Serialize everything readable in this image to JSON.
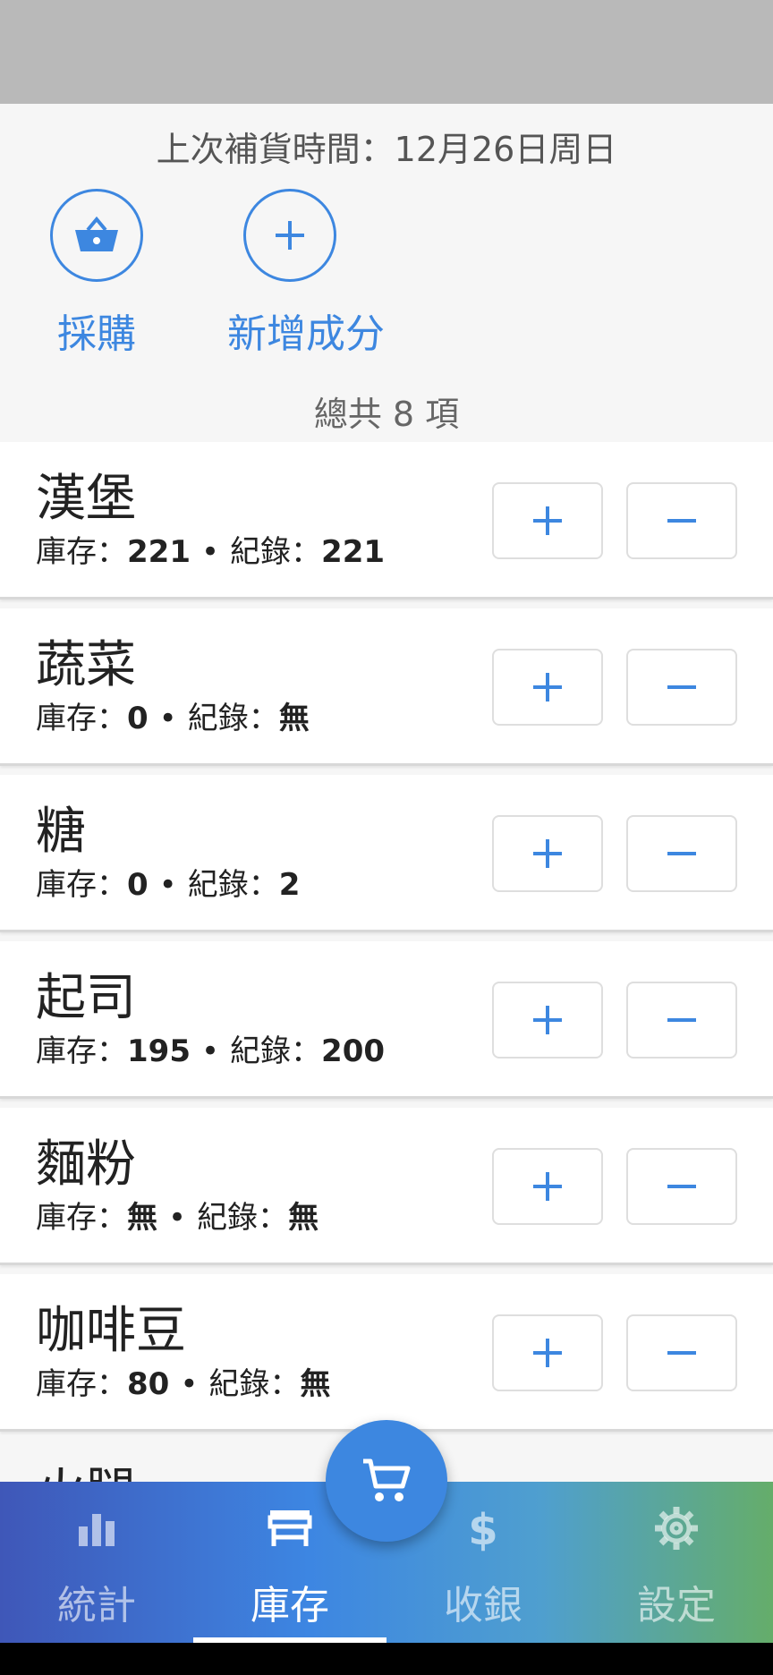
{
  "header": {
    "last_restock": "上次補貨時間：12月26日周日",
    "actions": [
      {
        "label": "採購",
        "icon": "basket-icon"
      },
      {
        "label": "新增成分",
        "icon": "add-circle-icon"
      }
    ],
    "total_count": "總共 8 項"
  },
  "inventory": {
    "stock_label": "庫存：",
    "record_label": "紀錄：",
    "separator": "•",
    "items": [
      {
        "name": "漢堡",
        "stock": "221",
        "record": "221"
      },
      {
        "name": "蔬菜",
        "stock": "0",
        "record": "無"
      },
      {
        "name": "糖",
        "stock": "0",
        "record": "2"
      },
      {
        "name": "起司",
        "stock": "195",
        "record": "200"
      },
      {
        "name": "麵粉",
        "stock": "無",
        "record": "無"
      },
      {
        "name": "咖啡豆",
        "stock": "80",
        "record": "無"
      }
    ],
    "partial_item": {
      "name": "火腿"
    }
  },
  "fab": {
    "icon": "cart-icon"
  },
  "bottom_nav": {
    "items": [
      {
        "label": "統計",
        "icon": "bar-chart-icon"
      },
      {
        "label": "庫存",
        "icon": "store-icon",
        "active": true
      },
      {
        "label": "收銀",
        "icon": "dollar-icon"
      },
      {
        "label": "設定",
        "icon": "gear-icon"
      }
    ]
  },
  "colors": {
    "accent": "#3d87e0",
    "nav_gradient_start": "#3f57b8",
    "nav_gradient_end": "#65ad6a",
    "status_bar": "#b9b9b9"
  }
}
